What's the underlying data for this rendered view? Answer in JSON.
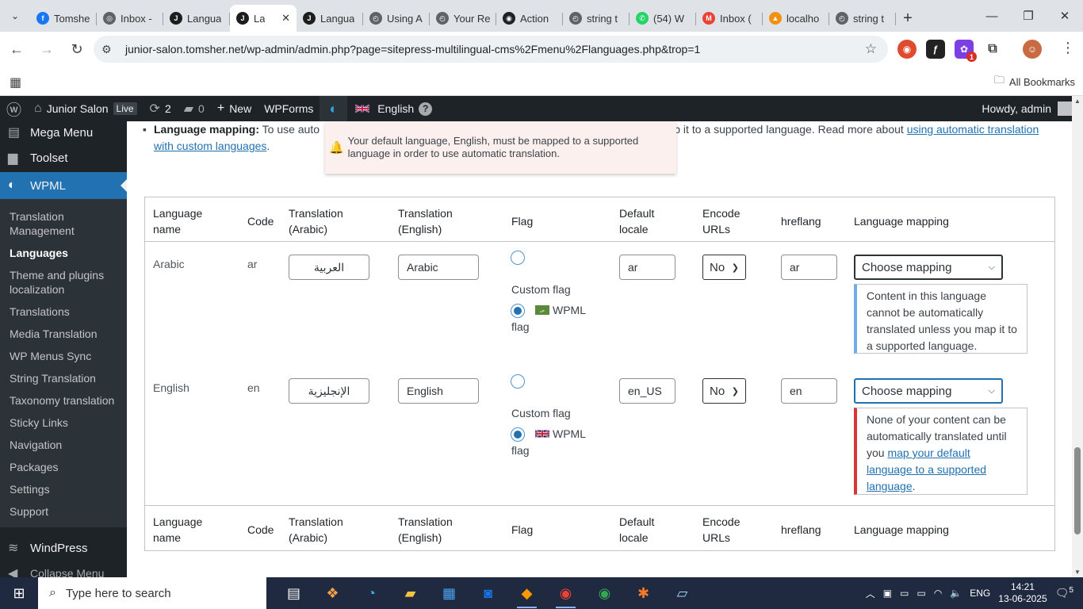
{
  "browser": {
    "tabs": [
      {
        "title": "Tomsher",
        "fav_color": "#1877f2",
        "fav_glyph": "f"
      },
      {
        "title": "Inbox -",
        "fav_color": "#5f6368",
        "fav_glyph": "◎"
      },
      {
        "title": "Langua",
        "fav_color": "#1d1d1d",
        "fav_glyph": "J"
      },
      {
        "title": "La",
        "fav_color": "#1d1d1d",
        "fav_glyph": "J",
        "active": true
      },
      {
        "title": "Langua",
        "fav_color": "#1d1d1d",
        "fav_glyph": "J"
      },
      {
        "title": "Using A",
        "fav_color": "#5f6368",
        "fav_glyph": "◴"
      },
      {
        "title": "Your Re",
        "fav_color": "#5f6368",
        "fav_glyph": "◴"
      },
      {
        "title": "Action",
        "fav_color": "#202124",
        "fav_glyph": "◉"
      },
      {
        "title": "string t",
        "fav_color": "#5f6368",
        "fav_glyph": "◴"
      },
      {
        "title": "(54) W",
        "fav_color": "#25d366",
        "fav_glyph": "✆"
      },
      {
        "title": "Inbox (",
        "fav_color": "#ea4335",
        "fav_glyph": "M"
      },
      {
        "title": "localho",
        "fav_color": "#f29111",
        "fav_glyph": "▲"
      },
      {
        "title": "string t",
        "fav_color": "#5f6368",
        "fav_glyph": "◴"
      }
    ],
    "url": "junior-salon.tomsher.net/wp-admin/admin.php?page=sitepress-multilingual-cms%2Fmenu%2Flanguages.php&trop=1",
    "all_bookmarks": "All Bookmarks",
    "ext_badge": "1"
  },
  "adminbar": {
    "site": "Junior Salon",
    "live": "Live",
    "updates": "2",
    "comments": "0",
    "new": "New",
    "wpforms": "WPForms",
    "language": "English",
    "help": "?",
    "howdy": "Howdy, admin"
  },
  "sidebar": {
    "top_items": [
      "Mega Menu",
      "Toolset"
    ],
    "active": "WPML",
    "submenu": [
      "Translation Management",
      "Languages",
      "Theme and plugins localization",
      "Translations",
      "Media Translation",
      "WP Menus Sync",
      "String Translation",
      "Taxonomy translation",
      "Sticky Links",
      "Navigation",
      "Packages",
      "Settings",
      "Support"
    ],
    "current": "Languages",
    "wordpress": "WindPress",
    "collapse": "Collapse Menu"
  },
  "note": {
    "label": "Language mapping:",
    "text_a": " To use auto",
    "text_b": "t map it to a supported language. Read more about ",
    "link": "using automatic translation with custom languages",
    "end": "."
  },
  "toast": {
    "message": "Your default language, English, must be mapped to a supported language in order to use automatic translation."
  },
  "table": {
    "headers": {
      "name": [
        "Language",
        "name"
      ],
      "code": "Code",
      "trans_ar": [
        "Translation",
        "(Arabic)"
      ],
      "trans_en": [
        "Translation",
        "(English)"
      ],
      "flag": "Flag",
      "locale": [
        "Default",
        "locale"
      ],
      "encode": [
        "Encode",
        "URLs"
      ],
      "hreflang": "hreflang",
      "mapping": "Language mapping"
    },
    "rows": [
      {
        "name": "Arabic",
        "code": "ar",
        "trans_ar": "العربية",
        "trans_en": "Arabic",
        "custom_flag": "Custom flag",
        "wpml_flag": "WPML",
        "flag_word": "flag",
        "locale": "ar",
        "encode": "No",
        "hreflang": "ar",
        "mapping": "Choose mapping",
        "notice": "Content in this language cannot be automatically translated unless you map it to a supported language."
      },
      {
        "name": "English",
        "code": "en",
        "trans_ar": "الإنجليزية",
        "trans_en": "English",
        "custom_flag": "Custom flag",
        "wpml_flag": "WPML",
        "flag_word": "flag",
        "locale": "en_US",
        "encode": "No",
        "hreflang": "en",
        "mapping": "Choose mapping",
        "notice_pre": "None of your content can be automatically translated until you ",
        "notice_link": "map your default language to a supported language",
        "notice_post": "."
      }
    ]
  },
  "taskbar": {
    "search": "Type here to search",
    "lang": "ENG",
    "time": "14:21",
    "date": "13-06-2025",
    "notifications": "5"
  },
  "colors": {
    "wp_blue": "#2271b1",
    "admin_dark": "#1d2327",
    "error_red": "#d63638",
    "info_blue": "#72aee6"
  }
}
